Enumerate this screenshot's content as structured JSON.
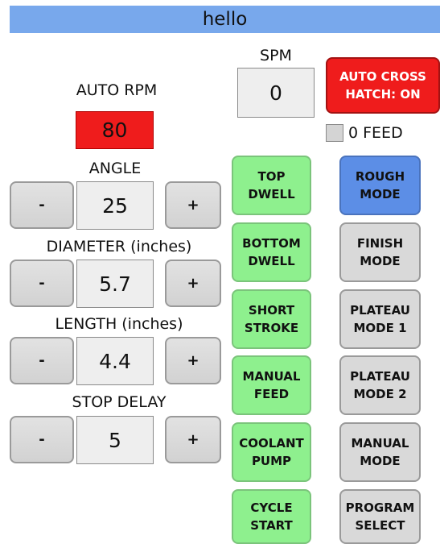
{
  "window": {
    "title": "hello"
  },
  "spm": {
    "label": "SPM",
    "value": "0"
  },
  "auto_cross_hatch": {
    "label_line1": "AUTO CROSS",
    "label_line2": "HATCH: ON",
    "color": "#ef1c1c"
  },
  "feed": {
    "label": "0 FEED"
  },
  "auto_rpm": {
    "label": "AUTO RPM",
    "value": "80",
    "color": "#ef1c1c"
  },
  "angle": {
    "label": "ANGLE",
    "value": "25",
    "minus": "-",
    "plus": "+"
  },
  "diameter": {
    "label": "DIAMETER (inches)",
    "value": "5.7",
    "minus": "-",
    "plus": "+"
  },
  "length": {
    "label": "LENGTH (inches)",
    "value": "4.4",
    "minus": "-",
    "plus": "+"
  },
  "stop_delay": {
    "label": "STOP DELAY",
    "value": "5",
    "minus": "-",
    "plus": "+"
  },
  "buttons_left": [
    {
      "line1": "TOP",
      "line2": "DWELL"
    },
    {
      "line1": "BOTTOM",
      "line2": "DWELL"
    },
    {
      "line1": "SHORT",
      "line2": "STROKE"
    },
    {
      "line1": "MANUAL",
      "line2": "FEED"
    },
    {
      "line1": "COOLANT",
      "line2": "PUMP"
    },
    {
      "line1": "CYCLE",
      "line2": "START"
    }
  ],
  "buttons_right": [
    {
      "line1": "ROUGH",
      "line2": "MODE"
    },
    {
      "line1": "FINISH",
      "line2": "MODE"
    },
    {
      "line1": "PLATEAU",
      "line2": "MODE 1"
    },
    {
      "line1": "PLATEAU",
      "line2": "MODE 2"
    },
    {
      "line1": "MANUAL",
      "line2": "MODE"
    },
    {
      "line1": "PROGRAM",
      "line2": "SELECT"
    }
  ],
  "colors": {
    "titlebar": "#78a8ec",
    "active_green": "#8ef08e",
    "selected_blue": "#5c8ee6",
    "neutral_gray": "#d9d9d9",
    "alert_red": "#ef1c1c"
  }
}
